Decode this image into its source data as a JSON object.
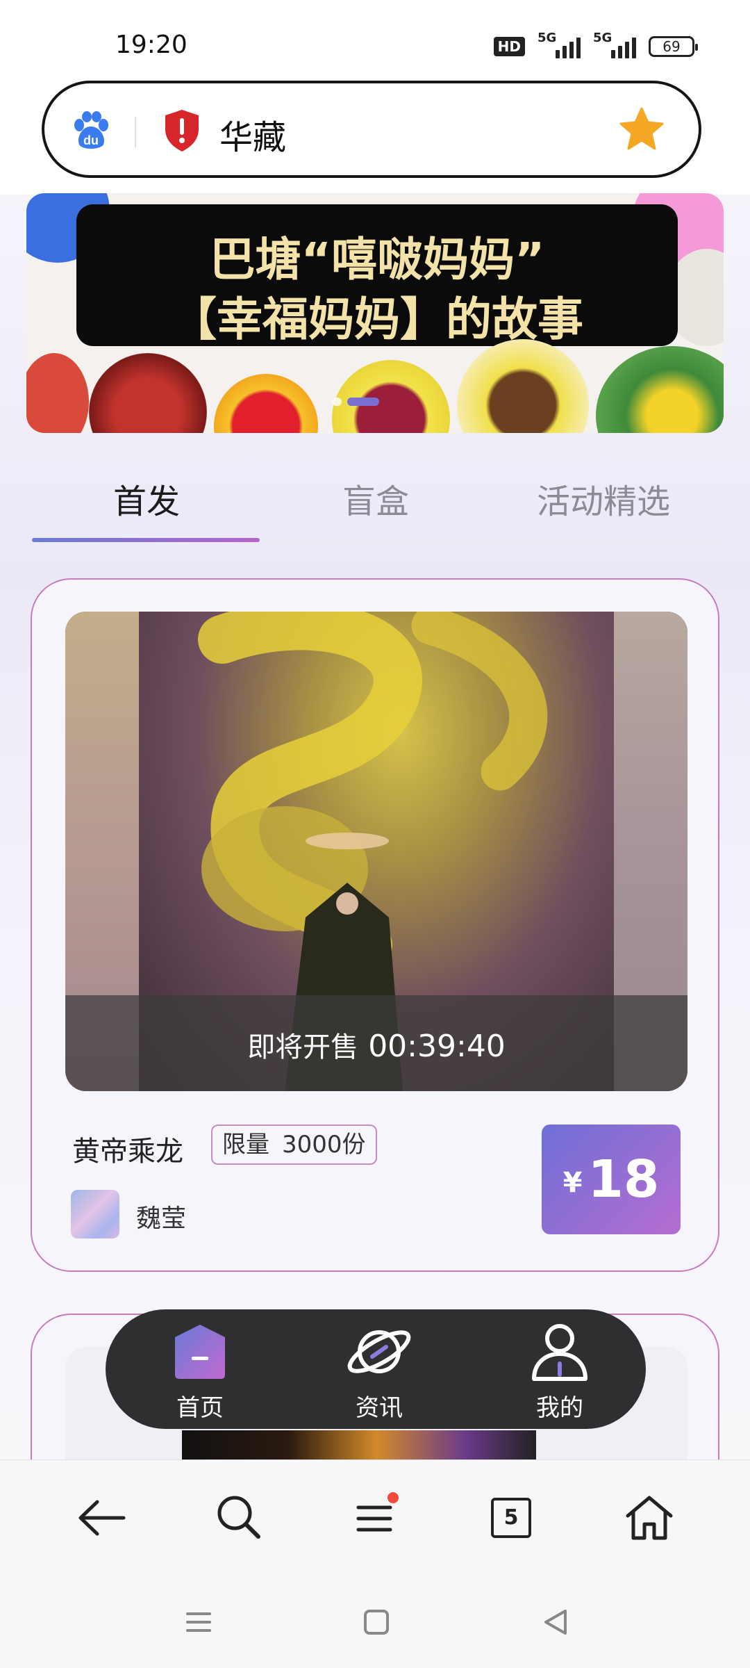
{
  "status_bar": {
    "time": "19:20",
    "hd_label": "HD",
    "signal1_label": "5G",
    "signal2_label": "5G",
    "battery": "69"
  },
  "address_bar": {
    "logo_icon": "baidu-paw-icon",
    "security_icon": "shield-alert-icon",
    "site_title": "华藏",
    "bookmark_icon": "star-icon"
  },
  "banner": {
    "title_line1": "巴塘“嘻啵妈妈”",
    "title_line2": "【幸福妈妈】的故事",
    "slide_count": 2,
    "active_slide": 2
  },
  "tabs": [
    {
      "label": "首发",
      "active": true
    },
    {
      "label": "盲盒",
      "active": false
    },
    {
      "label": "活动精选",
      "active": false
    }
  ],
  "product": {
    "sale_status": "即将开售",
    "countdown": "00:39:40",
    "name": "黄帝乘龙",
    "limit_label": "限量",
    "limit_count": "3000份",
    "artist": "魏莹",
    "currency": "¥",
    "price": "18"
  },
  "app_nav": [
    {
      "label": "首页",
      "icon": "home-hexagon-icon",
      "active": true
    },
    {
      "label": "资讯",
      "icon": "planet-icon",
      "active": false
    },
    {
      "label": "我的",
      "icon": "user-icon",
      "active": false
    }
  ],
  "browser_bar": {
    "back_icon": "back-arrow-icon",
    "search_icon": "search-icon",
    "menu_icon": "menu-icon",
    "tabs_count": "5",
    "home_icon": "home-icon"
  },
  "system_nav": [
    "recents-icon",
    "home-square-icon",
    "back-triangle-icon"
  ],
  "colors": {
    "accent_gradient_start": "#6b7ad6",
    "accent_gradient_end": "#b466c8",
    "card_border": "#c77bbd",
    "nav_bg": "#2f2f31"
  }
}
